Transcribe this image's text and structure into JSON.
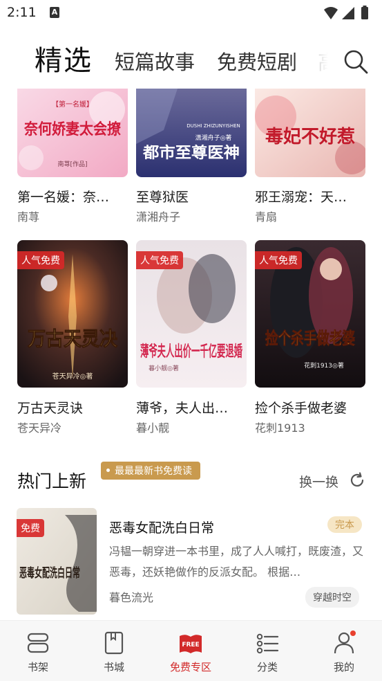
{
  "status_bar": {
    "time": "2:11",
    "notification_letter": "A"
  },
  "top_nav": {
    "tabs": [
      {
        "label": "精选",
        "active": true
      },
      {
        "label": "短篇故事",
        "active": false
      },
      {
        "label": "免费短剧",
        "active": false
      },
      {
        "label": "高",
        "active": false
      }
    ]
  },
  "books_row1": [
    {
      "title": "第一名媛：奈…",
      "author": "南荨",
      "cover_text": "奈何娇妻太会撩",
      "cover_sub": "【第一名媛】",
      "cover_credit": "南荨[作品]"
    },
    {
      "title": "至尊狱医",
      "author": "潇湘舟子",
      "cover_text": "都市至尊医神",
      "cover_sub": "DUSHI ZHIZUNYISHEN",
      "cover_credit": "潇湘舟子◎著"
    },
    {
      "title": "邪王溺宠：天…",
      "author": "青扇",
      "cover_text": "毒妃不好惹",
      "cover_sub": "",
      "cover_credit": ""
    }
  ],
  "books_row2": [
    {
      "title": "万古天灵诀",
      "author": "苍天异冷",
      "badge": "人气免费",
      "cover_text": "万古天灵决",
      "cover_credit": "苍天异冷◎著"
    },
    {
      "title": "薄爷，夫人出…",
      "author": "暮小靓",
      "badge": "人气免费",
      "cover_text": "薄爷夫人出价一千亿要退婚",
      "cover_credit": "暮小靓◎著"
    },
    {
      "title": "捡个杀手做老婆",
      "author": "花刺1913",
      "badge": "人气免费",
      "cover_text": "捡个杀手做老婆",
      "cover_credit": "花刺1913◎著"
    }
  ],
  "hot_section": {
    "title": "热门上新",
    "tag": "最最最新书免费读",
    "refresh_label": "换一换",
    "item": {
      "badge": "免费",
      "title": "恶毒女配洗白日常",
      "status": "完本",
      "description": "冯韫一朝穿进一本书里，成了人人喊打，既废渣，又恶毒，还妖艳做作的反派女配。 根据…",
      "author": "暮色流光",
      "genre": "穿越时空",
      "cover_text": "恶毒女配洗白日常"
    }
  },
  "bottom_nav": {
    "items": [
      {
        "label": "书架",
        "icon": "bookshelf-icon",
        "active": false
      },
      {
        "label": "书城",
        "icon": "book-icon",
        "active": false
      },
      {
        "label": "免费专区",
        "icon": "free-zone-icon",
        "active": true,
        "icon_text": "FREE"
      },
      {
        "label": "分类",
        "icon": "category-list-icon",
        "active": false
      },
      {
        "label": "我的",
        "icon": "profile-icon",
        "active": false
      }
    ]
  },
  "colors": {
    "accent_red": "#d22a2a",
    "gold": "#c99a4e",
    "text_dark": "#1a1a1a",
    "text_muted": "#666666"
  }
}
